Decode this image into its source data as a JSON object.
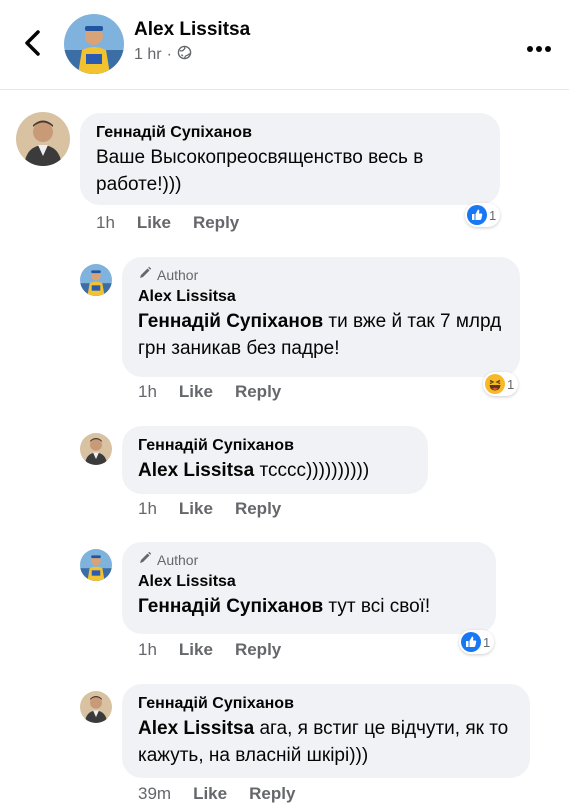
{
  "header": {
    "author_name": "Alex Lissitsa",
    "time": "1 hr",
    "separator": "·"
  },
  "comments": [
    {
      "name": "Геннадій Супіханов",
      "text": "Ваше Высокопреосвященство весь в работе!)))",
      "time": "1h",
      "like": "Like",
      "reply": "Reply",
      "reaction_count": "1",
      "reaction_type": "like"
    },
    {
      "author_tag": "Author",
      "name": "Alex Lissitsa",
      "mention": "Геннадій Супіханов",
      "text": " ти вже й так 7 млрд грн заникав без падре!",
      "time": "1h",
      "like": "Like",
      "reply": "Reply",
      "reaction_count": "1",
      "reaction_type": "haha"
    },
    {
      "name": "Геннадій Супіханов",
      "mention": "Alex Lissitsa",
      "text": " тсссс))))))))))",
      "time": "1h",
      "like": "Like",
      "reply": "Reply"
    },
    {
      "author_tag": "Author",
      "name": "Alex Lissitsa",
      "mention": "Геннадій Супіханов",
      "text": " тут всі свої!",
      "time": "1h",
      "like": "Like",
      "reply": "Reply",
      "reaction_count": "1",
      "reaction_type": "like"
    },
    {
      "name": "Геннадій Супіханов",
      "mention": "Alex Lissitsa",
      "text": " ага, я встиг це відчути, як то кажуть, на власній шкірі)))",
      "time": "39m",
      "like": "Like",
      "reply": "Reply"
    }
  ],
  "colors": {
    "bubble": "#f0f2f5",
    "secondary_text": "#65676b",
    "like_blue": "#1877f2",
    "haha_yellow": "#f7b928"
  }
}
